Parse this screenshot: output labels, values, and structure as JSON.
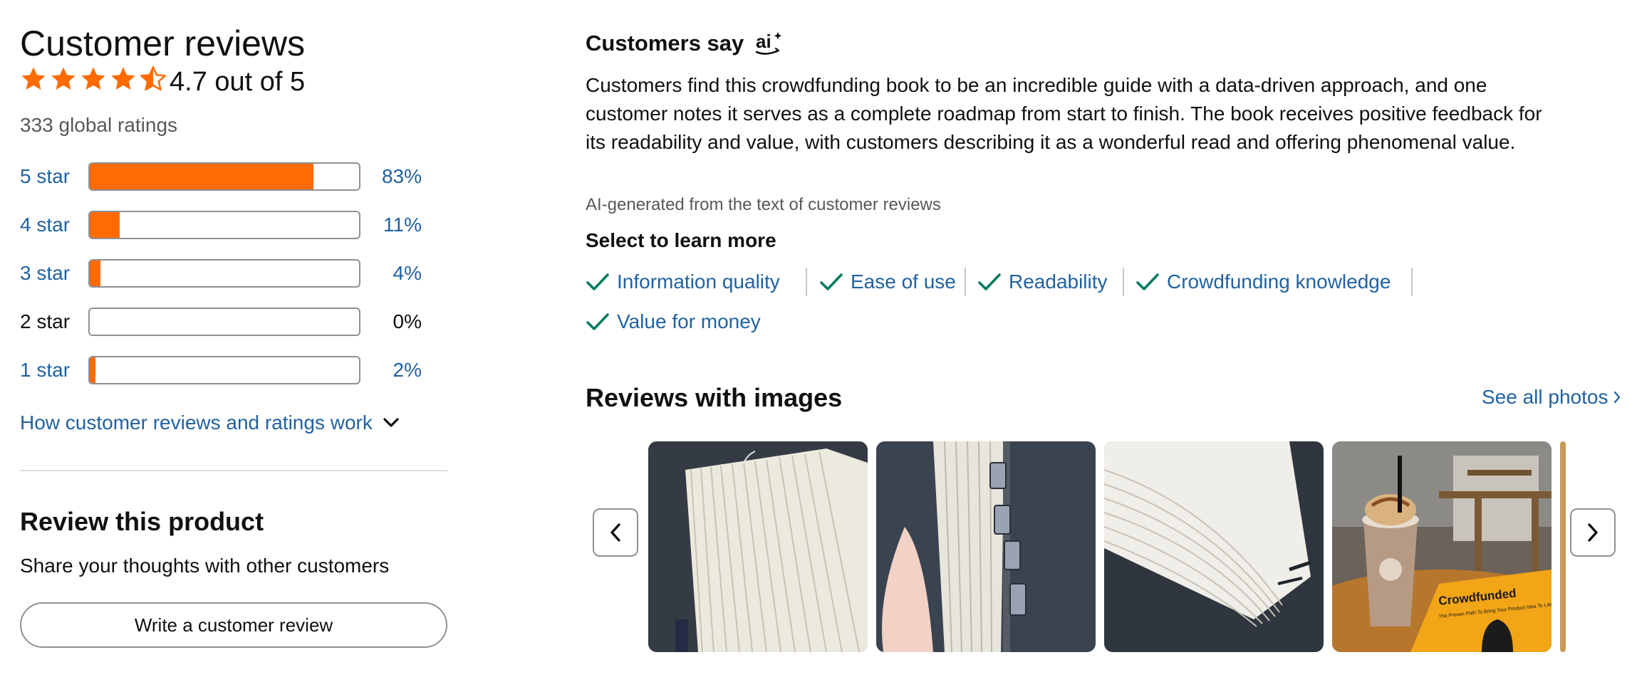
{
  "reviews_summary": {
    "title": "Customer reviews",
    "stars": 4.7,
    "rating_text": "4.7 out of 5",
    "global_ratings": "333 global ratings",
    "histogram": [
      {
        "label": "5 star",
        "percent_text": "83%",
        "percent": 83
      },
      {
        "label": "4 star",
        "percent_text": "11%",
        "percent": 11
      },
      {
        "label": "3 star",
        "percent_text": "4%",
        "percent": 4
      },
      {
        "label": "2 star",
        "percent_text": "0%",
        "percent": 0
      },
      {
        "label": "1 star",
        "percent_text": "2%",
        "percent": 2
      }
    ],
    "how_it_works": "How customer reviews and ratings work"
  },
  "review_product": {
    "title": "Review this product",
    "subtitle": "Share your thoughts with other customers",
    "button": "Write a customer review"
  },
  "customers_say": {
    "title": "Customers say",
    "summary": "Customers find this crowdfunding book to be an incredible guide with a data-driven approach, and one customer notes it serves as a complete roadmap from start to finish. The book receives positive feedback for its readability and value, with customers describing it as a wonderful read and offering phenomenal value.",
    "ai_note": "AI-generated from the text of customer reviews",
    "select_title": "Select to learn more",
    "aspects": [
      "Information quality",
      "Ease of use",
      "Readability",
      "Crowdfunding knowledge",
      "Value for money"
    ]
  },
  "reviews_with_images": {
    "title": "Reviews with images",
    "see_all": "See all photos",
    "book_cover_title": "Crowdfunded",
    "book_cover_subtitle": "The Proven Path To Bring Your Product Idea To Life"
  },
  "colors": {
    "star": "#ff6b00",
    "link": "#2162a1",
    "check": "#067d62"
  }
}
